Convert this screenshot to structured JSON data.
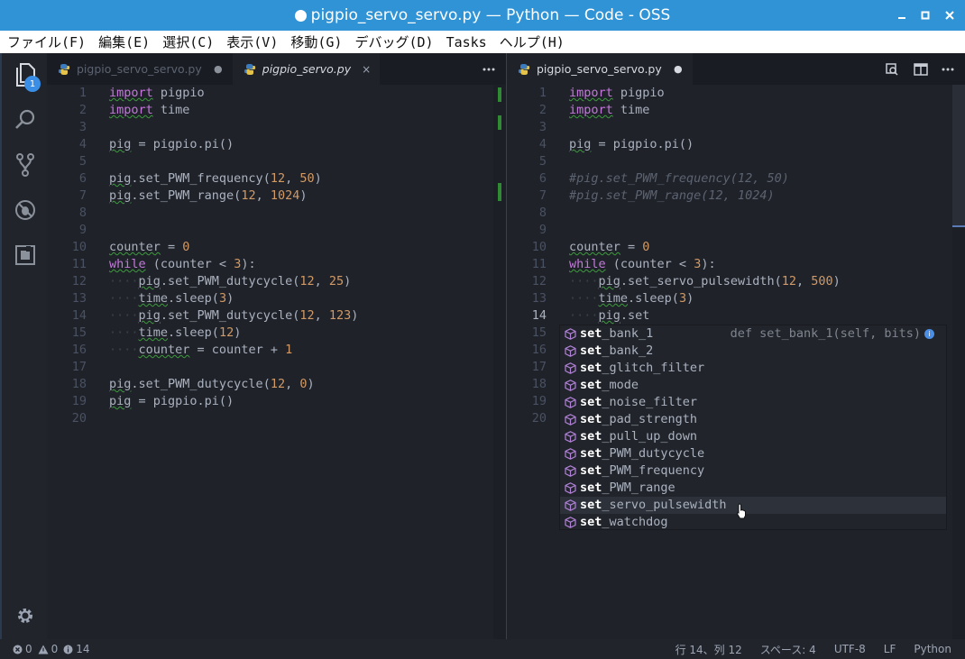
{
  "window": {
    "title": "pigpio_servo_servo.py — Python — Code - OSS"
  },
  "menu": [
    "ファイル(F)",
    "編集(E)",
    "選択(C)",
    "表示(V)",
    "移動(G)",
    "デバッグ(D)",
    "Tasks",
    "ヘルプ(H)"
  ],
  "activity": {
    "explorer_badge": "1"
  },
  "left_group": {
    "tabs": [
      {
        "label": "pigpio_servo_servo.py",
        "marker": "●"
      },
      {
        "label": "pigpio_servo.py",
        "close": "×"
      }
    ],
    "lines": [
      {
        "n": "1",
        "t": "import pigpio"
      },
      {
        "n": "2",
        "t": "import time"
      },
      {
        "n": "3",
        "t": ""
      },
      {
        "n": "4",
        "t": "pig = pigpio.pi()"
      },
      {
        "n": "5",
        "t": ""
      },
      {
        "n": "6",
        "t": "pig.set_PWM_frequency(12, 50)"
      },
      {
        "n": "7",
        "t": "pig.set_PWM_range(12, 1024)"
      },
      {
        "n": "8",
        "t": ""
      },
      {
        "n": "9",
        "t": ""
      },
      {
        "n": "10",
        "t": "counter = 0"
      },
      {
        "n": "11",
        "t": "while (counter < 3):"
      },
      {
        "n": "12",
        "t": "    pig.set_PWM_dutycycle(12, 25)"
      },
      {
        "n": "13",
        "t": "    time.sleep(3)"
      },
      {
        "n": "14",
        "t": "    pig.set_PWM_dutycycle(12, 123)"
      },
      {
        "n": "15",
        "t": "    time.sleep(12)"
      },
      {
        "n": "16",
        "t": "    counter = counter + 1"
      },
      {
        "n": "17",
        "t": ""
      },
      {
        "n": "18",
        "t": "pig.set_PWM_dutycycle(12, 0)"
      },
      {
        "n": "19",
        "t": "pig = pigpio.pi()"
      },
      {
        "n": "20",
        "t": ""
      }
    ]
  },
  "right_group": {
    "tabs": [
      {
        "label": "pigpio_servo_servo.py",
        "marker": "●"
      }
    ],
    "lines": [
      {
        "n": "1",
        "t": "import pigpio"
      },
      {
        "n": "2",
        "t": "import time"
      },
      {
        "n": "3",
        "t": ""
      },
      {
        "n": "4",
        "t": "pig = pigpio.pi()"
      },
      {
        "n": "5",
        "t": ""
      },
      {
        "n": "6",
        "t": "#pig.set_PWM_frequency(12, 50)"
      },
      {
        "n": "7",
        "t": "#pig.set_PWM_range(12, 1024)"
      },
      {
        "n": "8",
        "t": ""
      },
      {
        "n": "9",
        "t": ""
      },
      {
        "n": "10",
        "t": "counter = 0"
      },
      {
        "n": "11",
        "t": "while (counter < 3):"
      },
      {
        "n": "12",
        "t": "    pig.set_servo_pulsewidth(12, 500)"
      },
      {
        "n": "13",
        "t": "    time.sleep(3)"
      },
      {
        "n": "14",
        "t": "    pig.set"
      },
      {
        "n": "15",
        "t": ""
      },
      {
        "n": "16",
        "t": ""
      },
      {
        "n": "17",
        "t": ""
      },
      {
        "n": "18",
        "t": ""
      },
      {
        "n": "19",
        "t": ""
      },
      {
        "n": "20",
        "t": ""
      }
    ]
  },
  "suggest": {
    "match": "set",
    "items": [
      {
        "rest": "_bank_1",
        "detail": "def set_bank_1(self, bits)",
        "info": "i"
      },
      {
        "rest": "_bank_2"
      },
      {
        "rest": "_glitch_filter"
      },
      {
        "rest": "_mode"
      },
      {
        "rest": "_noise_filter"
      },
      {
        "rest": "_pad_strength"
      },
      {
        "rest": "_pull_up_down"
      },
      {
        "rest": "_PWM_dutycycle"
      },
      {
        "rest": "_PWM_frequency"
      },
      {
        "rest": "_PWM_range"
      },
      {
        "rest": "_servo_pulsewidth"
      },
      {
        "rest": "_watchdog"
      }
    ]
  },
  "status": {
    "errors": "0",
    "warnings": "0",
    "infos": "14",
    "position": "行 14、列 12",
    "spaces": "スペース: 4",
    "encoding": "UTF-8",
    "eol": "LF",
    "language": "Python"
  },
  "colors": {
    "title_bar": "#2f93d6",
    "editor_bg": "#1f2229",
    "keyword": "#c678dd",
    "number": "#d19a66",
    "badge": "#3a8ee6"
  }
}
